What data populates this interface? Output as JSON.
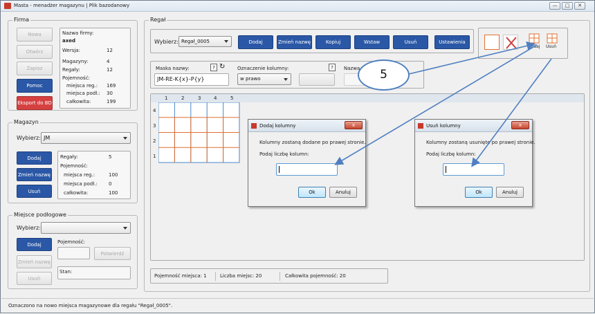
{
  "window": {
    "title": "Masta - menadżer magazynu | Plik bazodanowy",
    "buttons": [
      "—",
      "□",
      "✕"
    ]
  },
  "firma": {
    "legend": "Firma",
    "buttons": {
      "nowa": "Nowa",
      "otworz": "Otwórz",
      "zapisz": "Zapisz",
      "pomoc": "Pomoc",
      "eksport": "Eksport do BD"
    },
    "info": {
      "nazwa_label": "Nazwa firmy:",
      "nazwa_value": "axed",
      "wersja_label": "Wersja:",
      "wersja_value": "12",
      "magazyny_label": "Magazyny:",
      "magazyny_value": "4",
      "regaly_label": "Regały:",
      "regaly_value": "12",
      "pojemnosc_label": "Pojemność:",
      "reg_label": "miejsca reg.:",
      "reg_value": "169",
      "podl_label": "miejsca podł.:",
      "podl_value": "30",
      "calk_label": "całkowita:",
      "calk_value": "199"
    }
  },
  "magazyn": {
    "legend": "Magazyn",
    "wybierz_label": "Wybierz:",
    "selected": "JM",
    "buttons": {
      "dodaj": "Dodaj",
      "zmien": "Zmień nazwę",
      "usun": "Usuń"
    },
    "info": {
      "regaly_label": "Regały:",
      "regaly_value": "5",
      "pojemnosc_label": "Pojemność:",
      "reg_label": "miejsca reg.:",
      "reg_value": "100",
      "podl_label": "miejsca podł.:",
      "podl_value": "0",
      "calk_label": "całkowita:",
      "calk_value": "100"
    }
  },
  "miejsce": {
    "legend": "Miejsce podłogowe",
    "wybierz_label": "Wybierz:",
    "selected": "",
    "buttons": {
      "dodaj": "Dodaj",
      "zmien": "Zmień nazwę",
      "usun": "Usuń",
      "potwierdz": "Potwierdź"
    },
    "pojemnosc_label": "Pojemność:",
    "stan_label": "Stan:"
  },
  "regal": {
    "legend": "Regał",
    "wybierz_label": "Wybierz:",
    "selected": "Regał_0005",
    "buttons": {
      "dodaj": "Dodaj",
      "zmien": "Zmień nazwę",
      "kopiuj": "Kopiuj",
      "wstaw": "Wstaw",
      "usun": "Usuń",
      "ustawienia": "Ustawienia"
    },
    "maska_label": "Maska nazwy:",
    "maska_help": "?",
    "maska_value": "JM-RE-K{x}-P{y}",
    "oznaczenie_label": "Oznaczenie kolumny:",
    "oznaczenie_help": "?",
    "oznaczenie_value": "w prawo",
    "nazwa_label": "Nazwa",
    "mini_buttons": {
      "dodaj": "Dodaj",
      "usun": "Usuń"
    },
    "columns": [
      "1",
      "2",
      "3",
      "4",
      "5"
    ],
    "rows": [
      "4",
      "3",
      "2",
      "1"
    ]
  },
  "annotation": {
    "number": "5"
  },
  "dialog_add": {
    "title": "Dodaj kolumny",
    "message": "Kolumny zostaną dodane po prawej stronie.",
    "prompt": "Podaj liczbę kolumn:",
    "value": "",
    "ok": "Ok",
    "cancel": "Anuluj"
  },
  "dialog_remove": {
    "title": "Usuń kolumny",
    "message": "Kolumny zostaną usunięte po prawej stronie.",
    "prompt": "Podaj liczbę kolumn:",
    "value": "",
    "ok": "Ok",
    "cancel": "Anuluj"
  },
  "summary": {
    "pojemnosc_miejsca": "Pojemność miejsca: 1",
    "liczba_miejsc": "Liczba miejsc: 20",
    "calkowita": "Całkowita pojemność: 20"
  },
  "status": "Oznaczono na nowo miejsca magazynowe dla regału \"Regał_0005\".",
  "colors": {
    "blue_button": "#2b58a6",
    "red_button": "#d64040",
    "arrow": "#4f7fc0",
    "grid_line": "#4a87c6",
    "grid_cross": "#e07030"
  }
}
